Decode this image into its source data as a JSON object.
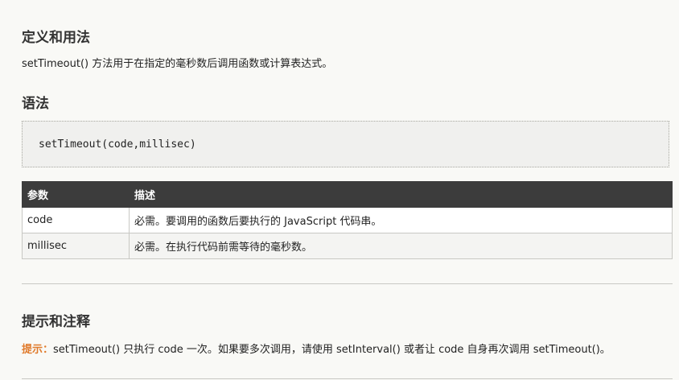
{
  "definition": {
    "heading": "定义和用法",
    "text": "setTimeout() 方法用于在指定的毫秒数后调用函数或计算表达式。"
  },
  "syntax": {
    "heading": "语法",
    "code": "setTimeout(code,millisec)"
  },
  "params_table": {
    "headers": [
      "参数",
      "描述"
    ],
    "rows": [
      {
        "name": "code",
        "desc": "必需。要调用的函数后要执行的 JavaScript 代码串。"
      },
      {
        "name": "millisec",
        "desc": "必需。在执行代码前需等待的毫秒数。"
      }
    ]
  },
  "tips": {
    "heading": "提示和注释",
    "label": "提示：",
    "text": "setTimeout() 只执行 code 一次。如果要多次调用，请使用 setInterval() 或者让 code 自身再次调用 setTimeout()。"
  },
  "colors": {
    "background": "#f9f9f6",
    "table_header_bg": "#3c3c3c",
    "tip_label": "#e07b2c"
  }
}
